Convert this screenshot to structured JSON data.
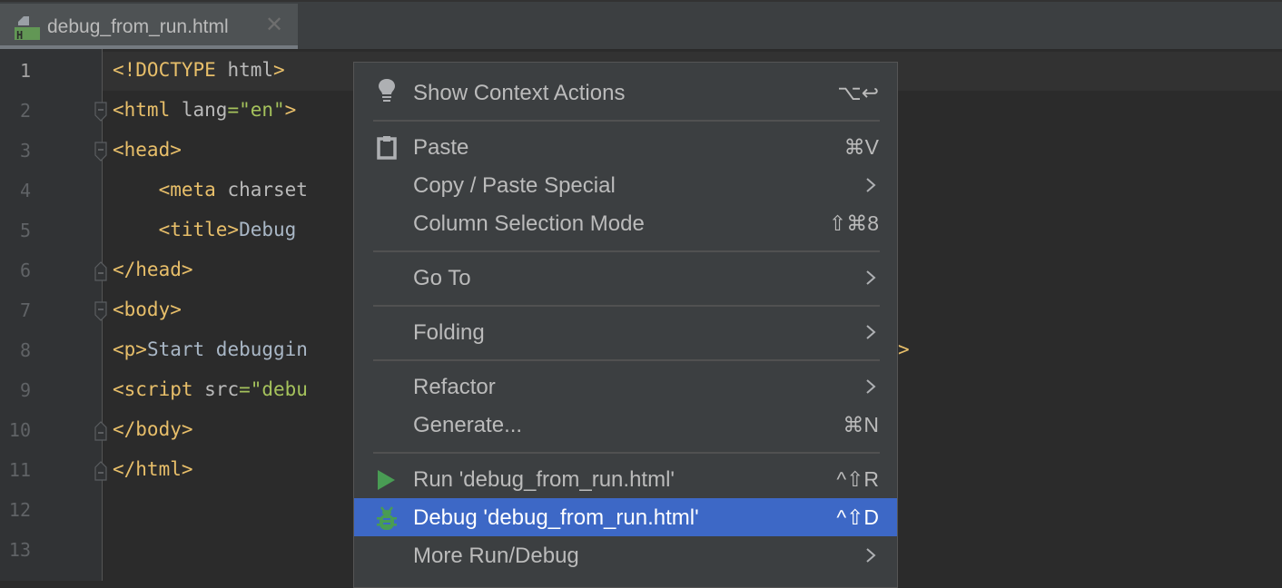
{
  "tab": {
    "filename": "debug_from_run.html",
    "icon": "html-file-icon",
    "close_icon": "close-icon",
    "colors": {
      "icon_badge": "#629755"
    }
  },
  "editor": {
    "current_line": 1,
    "line_numbers": [
      "1",
      "2",
      "3",
      "4",
      "5",
      "6",
      "7",
      "8",
      "9",
      "10",
      "11",
      "12",
      "13"
    ],
    "lines": [
      [
        {
          "t": "tag",
          "v": "<!DOCTYPE "
        },
        {
          "t": "attr",
          "v": "html"
        },
        {
          "t": "tag",
          "v": ">"
        }
      ],
      [
        {
          "t": "tag",
          "v": "<html "
        },
        {
          "t": "attr",
          "v": "lang"
        },
        {
          "t": "str",
          "v": "=\"en\""
        },
        {
          "t": "tag",
          "v": ">"
        }
      ],
      [
        {
          "t": "tag",
          "v": "<head>"
        }
      ],
      [
        {
          "t": "txt",
          "v": "    "
        },
        {
          "t": "tag",
          "v": "<meta "
        },
        {
          "t": "attr",
          "v": "charset"
        }
      ],
      [
        {
          "t": "txt",
          "v": "    "
        },
        {
          "t": "tag",
          "v": "<title>"
        },
        {
          "t": "txt",
          "v": "Debug"
        }
      ],
      [
        {
          "t": "tag",
          "v": "</head>"
        }
      ],
      [
        {
          "t": "tag",
          "v": "<body>"
        }
      ],
      [
        {
          "t": "tag",
          "v": "<p>"
        },
        {
          "t": "txt",
          "v": "Start debuggin"
        }
      ],
      [
        {
          "t": "tag",
          "v": "<script "
        },
        {
          "t": "attr",
          "v": "src"
        },
        {
          "t": "str",
          "v": "=\"debu"
        }
      ],
      [
        {
          "t": "tag",
          "v": "</body>"
        }
      ],
      [
        {
          "t": "tag",
          "v": "</html>"
        }
      ],
      [],
      []
    ],
    "line8_tail": ">",
    "fold_markers": [
      {
        "line": 2,
        "type": "start"
      },
      {
        "line": 3,
        "type": "start"
      },
      {
        "line": 6,
        "type": "end"
      },
      {
        "line": 7,
        "type": "start"
      },
      {
        "line": 10,
        "type": "end"
      },
      {
        "line": 11,
        "type": "end"
      }
    ]
  },
  "context_menu": {
    "items": [
      {
        "label": "Show Context Actions",
        "shortcut": "⌥↩",
        "icon": "lightbulb-icon",
        "submenu": false
      },
      {
        "separator": true
      },
      {
        "label": "Paste",
        "shortcut": "⌘V",
        "icon": "clipboard-icon",
        "submenu": false
      },
      {
        "label": "Copy / Paste Special",
        "shortcut": "",
        "icon": "",
        "submenu": true
      },
      {
        "label": "Column Selection Mode",
        "shortcut": "⇧⌘8",
        "icon": "",
        "submenu": false
      },
      {
        "separator": true
      },
      {
        "label": "Go To",
        "shortcut": "",
        "icon": "",
        "submenu": true
      },
      {
        "separator": true
      },
      {
        "label": "Folding",
        "shortcut": "",
        "icon": "",
        "submenu": true
      },
      {
        "separator": true
      },
      {
        "label": "Refactor",
        "shortcut": "",
        "icon": "",
        "submenu": true
      },
      {
        "label": "Generate...",
        "shortcut": "⌘N",
        "icon": "",
        "submenu": false
      },
      {
        "separator": true
      },
      {
        "label": "Run 'debug_from_run.html'",
        "shortcut": "^⇧R",
        "icon": "run-icon",
        "submenu": false
      },
      {
        "label": "Debug 'debug_from_run.html'",
        "shortcut": "^⇧D",
        "icon": "debug-bug-icon",
        "submenu": false,
        "selected": true
      },
      {
        "label": "More Run/Debug",
        "shortcut": "",
        "icon": "",
        "submenu": true
      }
    ],
    "colors": {
      "selected_bg": "#3d68c6",
      "run_icon": "#499c54",
      "debug_icon": "#499c54"
    }
  }
}
